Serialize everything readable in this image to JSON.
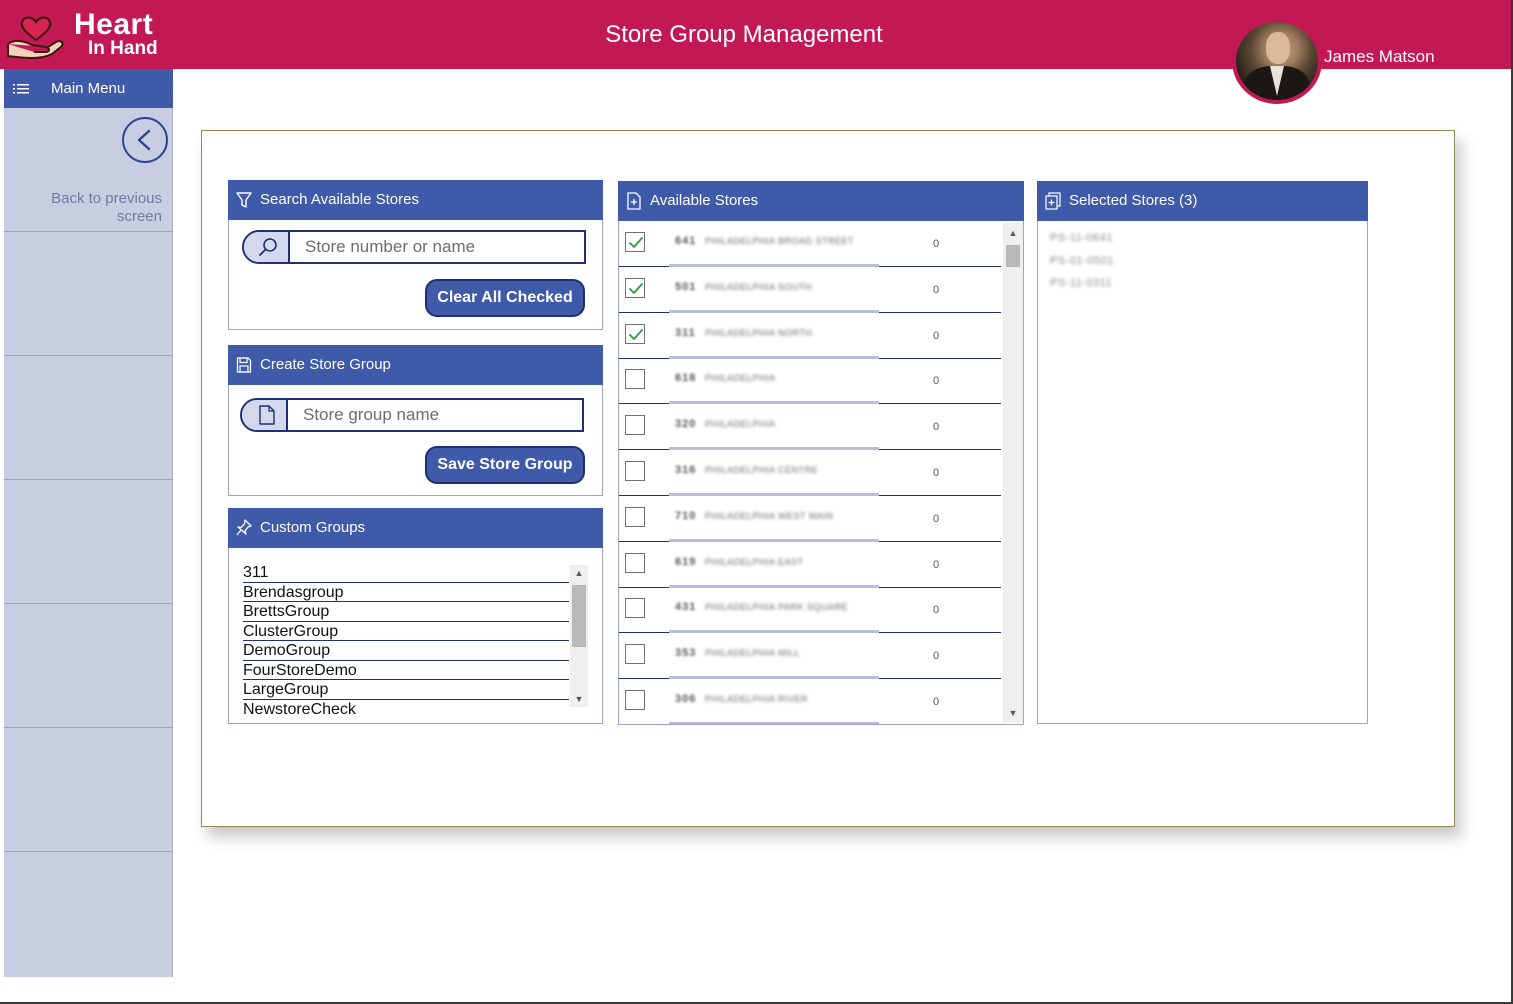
{
  "header": {
    "logo_title": "Heart",
    "logo_subtitle": "In Hand",
    "page_title": "Store Group Management",
    "user_name": "James Matson",
    "bg_color": "#c21854"
  },
  "sidebar": {
    "main_menu_label": "Main Menu",
    "back_label": "Back to previous screen"
  },
  "search_panel": {
    "title": "Search Available Stores",
    "search_placeholder": "Store number or name",
    "clear_button": "Clear All Checked"
  },
  "create_panel": {
    "title": "Create Store Group",
    "name_placeholder": "Store group name",
    "save_button": "Save Store Group"
  },
  "custom_groups": {
    "title": "Custom Groups",
    "items": [
      "311",
      "Brendasgroup",
      "BrettsGroup",
      "ClusterGroup",
      "DemoGroup",
      "FourStoreDemo",
      "LargeGroup",
      "NewstoreCheck"
    ]
  },
  "available_stores": {
    "title": "Available Stores",
    "rows": [
      {
        "checked": true,
        "number": "641",
        "name": "PHILADELPHIA BROAD STREET",
        "count": "0"
      },
      {
        "checked": true,
        "number": "501",
        "name": "PHILADELPHIA SOUTH",
        "count": "0"
      },
      {
        "checked": true,
        "number": "311",
        "name": "PHILADELPHIA NORTH",
        "count": "0"
      },
      {
        "checked": false,
        "number": "618",
        "name": "PHILADELPHIA",
        "count": "0"
      },
      {
        "checked": false,
        "number": "320",
        "name": "PHILADELPHIA",
        "count": "0"
      },
      {
        "checked": false,
        "number": "316",
        "name": "PHILADELPHIA CENTRE",
        "count": "0"
      },
      {
        "checked": false,
        "number": "710",
        "name": "PHILADELPHIA WEST MAIN",
        "count": "0"
      },
      {
        "checked": false,
        "number": "619",
        "name": "PHILADELPHIA EAST",
        "count": "0"
      },
      {
        "checked": false,
        "number": "431",
        "name": "PHILADELPHIA PARK SQUARE",
        "count": "0"
      },
      {
        "checked": false,
        "number": "353",
        "name": "PHILADELPHIA MILL",
        "count": "0"
      },
      {
        "checked": false,
        "number": "306",
        "name": "PHILADELPHIA RIVER",
        "count": "0"
      }
    ]
  },
  "selected_stores": {
    "title": "Selected Stores (3)",
    "items": [
      "PS-11-0641",
      "PS-01-0501",
      "PS-11-0311"
    ]
  }
}
